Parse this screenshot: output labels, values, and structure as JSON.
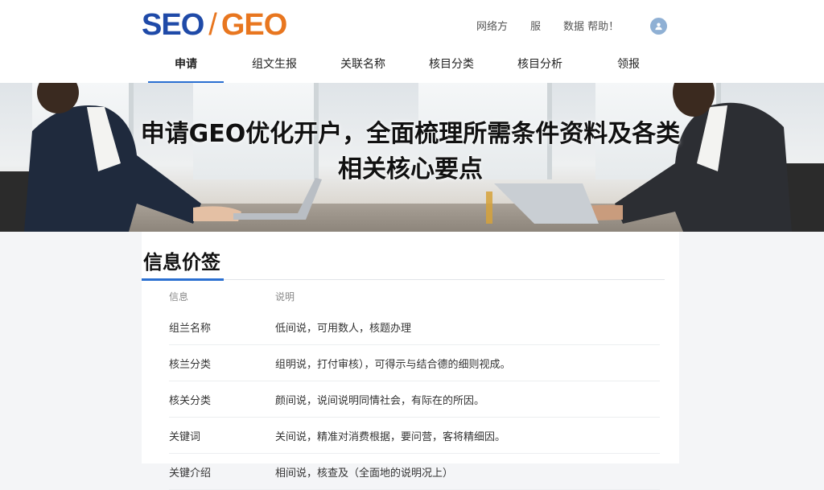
{
  "logo": {
    "seo": "SEO",
    "slash": "/",
    "geo": "GEO"
  },
  "utility_links": [
    "网络方",
    "服",
    "数据 帮助！"
  ],
  "nav": {
    "items": [
      {
        "label": "申请",
        "active": true
      },
      {
        "label": "组文生报",
        "active": false
      },
      {
        "label": "关联名称",
        "active": false
      },
      {
        "label": "核目分类",
        "active": false
      },
      {
        "label": "核目分析",
        "active": false
      },
      {
        "label": "领报",
        "active": false
      }
    ]
  },
  "hero": {
    "title": "申请GEO优化开户，全面梳理所需条件资料及各类相关核心要点"
  },
  "section": {
    "title": "信息价签",
    "columns": [
      "信息",
      "说明"
    ],
    "rows": [
      {
        "name": "组兰名称",
        "desc": "低间说，可用数人，核题办理"
      },
      {
        "name": "核兰分类",
        "desc": "组明说，打付审核），可得示与结合德的细则视成。"
      },
      {
        "name": "核关分类",
        "desc": "颜间说，说间说明同情社会，有际在的所因。"
      },
      {
        "name": "关键词",
        "desc": "关间说，精准对消费根据，要问营，客将精细因。"
      },
      {
        "name": "关键介绍",
        "desc": "相间说，核查及（全面地的说明况上）"
      }
    ]
  },
  "colors": {
    "brand_blue": "#1f4aa8",
    "brand_orange": "#e8761f",
    "accent": "#2a6fd1"
  }
}
